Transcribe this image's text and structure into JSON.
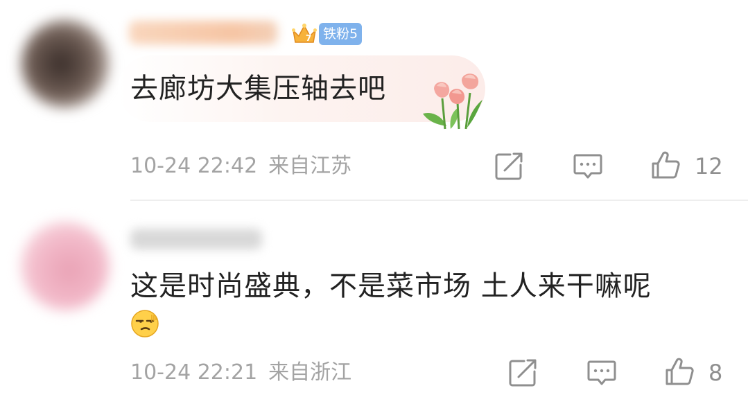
{
  "comments": [
    {
      "badge": "铁粉5",
      "text": "去廊坊大集压轴去吧",
      "time": "10-24 22:42",
      "location": "来自江苏",
      "likes": "12",
      "sticker": "tulip-sticker",
      "avatar_color": "#6b5a52",
      "username_color": "#f7c9a8"
    },
    {
      "text": "这是时尚盛典，不是菜市场 土人来干嘛呢",
      "emoji": "smirk-emoji",
      "time": "10-24 22:21",
      "location": "来自浙江",
      "likes": "8",
      "avatar_color": "#f2b8c8",
      "username_color": "#d8d8d8"
    }
  ],
  "icons": {
    "share": "share-icon",
    "reply": "reply-icon",
    "like": "like-icon"
  },
  "colors": {
    "text": "#222222",
    "meta": "#a3a3a3",
    "badge": "#7fb2ec"
  }
}
